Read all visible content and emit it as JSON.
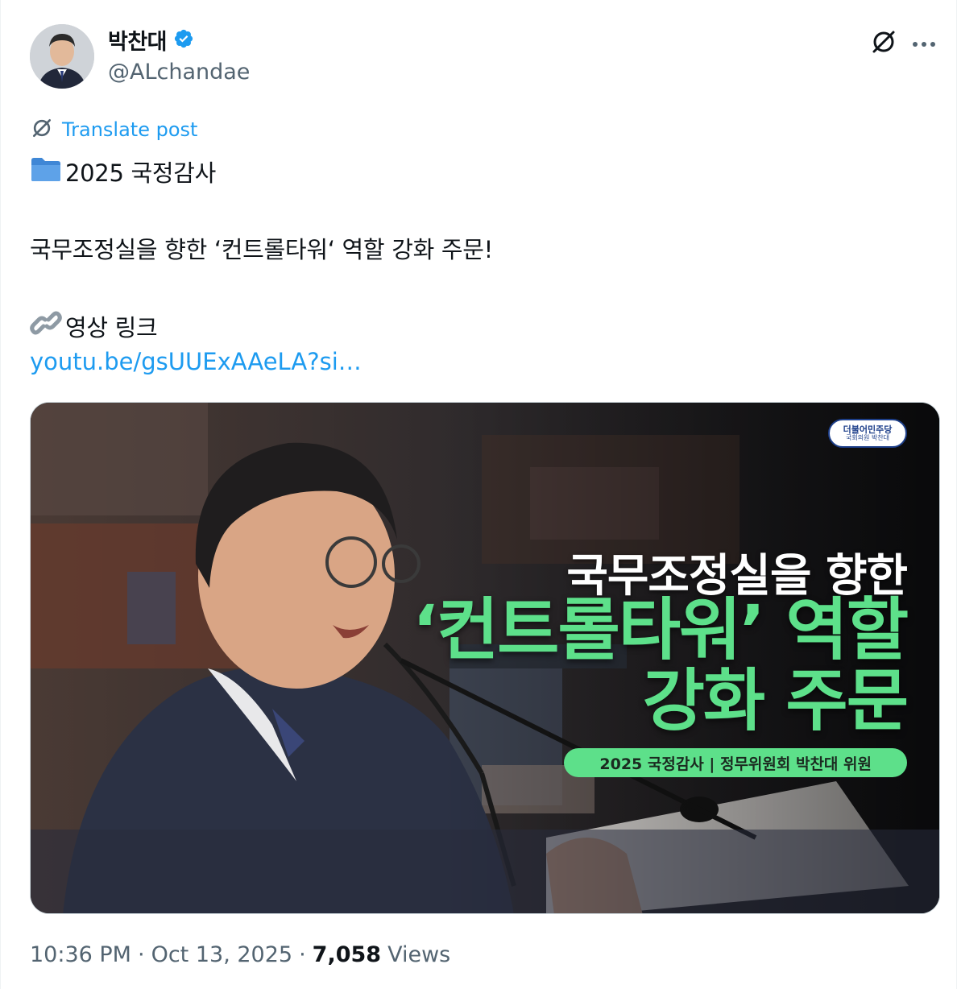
{
  "author": {
    "display_name": "박찬대",
    "handle": "@ALchandae",
    "verified_icon": "verified-badge-icon",
    "verified_color": "#1d9bf0"
  },
  "actions": {
    "grok_icon": "grok-icon",
    "more_icon": "more-dots-icon"
  },
  "translate": {
    "label": "Translate post",
    "icon": "grok-icon"
  },
  "post": {
    "line1_icon": "folder-icon",
    "line1": "2025 국정감사",
    "line2": "국무조정실을 향한 ‘컨트롤타워‘ 역할 강화 주문!",
    "line3_icon": "link-icon",
    "line3": "영상 링크",
    "link": "youtu.be/gsUUExAAeLA?si…"
  },
  "media": {
    "headline_1": "국무조정실을 향한",
    "headline_2": "‘컨트롤타워’ 역할",
    "headline_3": "강화 주문",
    "caption": "2025 국정감사 | 정무위원회 박찬대 위원",
    "party_badge_name": "더불어민주당",
    "party_badge_sub": "국회의원 박찬대",
    "accent_color": "#5de08a"
  },
  "footer": {
    "time": "10:36 PM",
    "date": "Oct 13, 2025",
    "views_count": "7,058",
    "views_label": "Views",
    "separator": "·"
  }
}
